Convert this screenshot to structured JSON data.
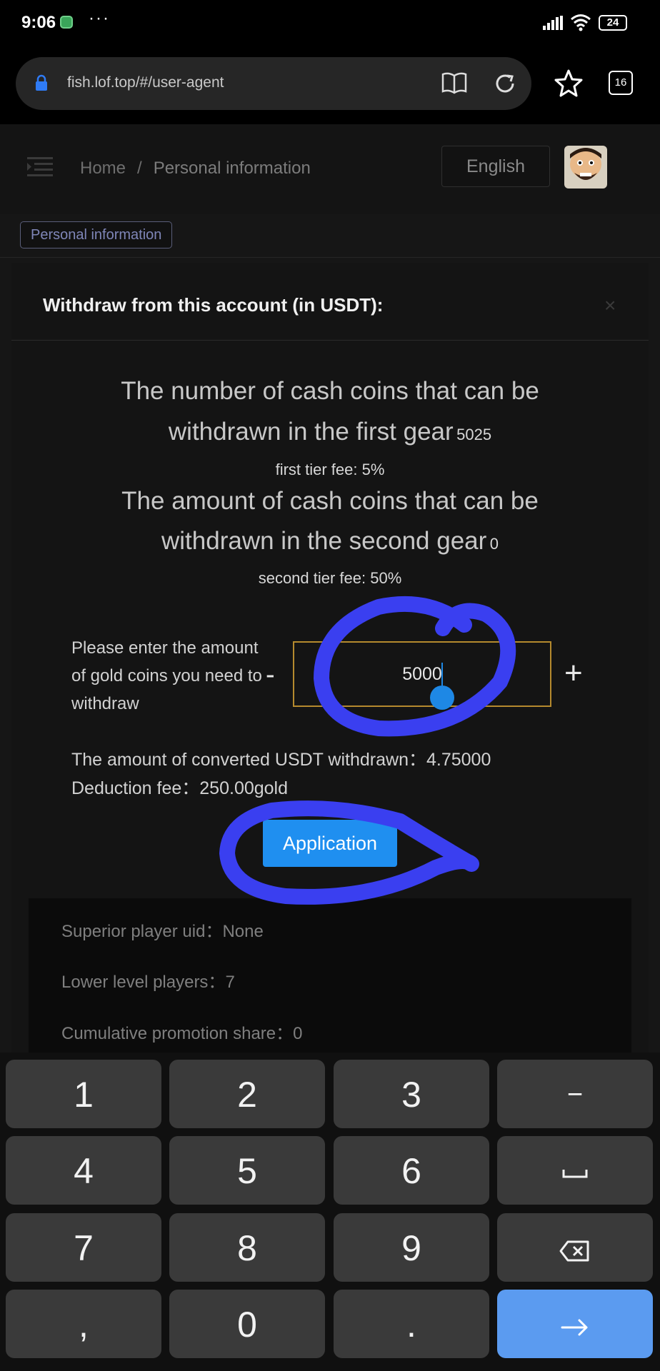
{
  "status_bar": {
    "time": "9:06",
    "dots": "···",
    "battery": "24"
  },
  "browser": {
    "url": "fish.lof.top/#/user-agent",
    "tab_count": "16"
  },
  "header": {
    "breadcrumb_home": "Home",
    "breadcrumb_sep": "/",
    "breadcrumb_current": "Personal information",
    "language": "English"
  },
  "tag": {
    "label": "Personal information"
  },
  "modal": {
    "title": "Withdraw from this account (in USDT):",
    "close": "×",
    "first_gear_line1": "The number of cash coins that can be",
    "first_gear_line2": "withdrawn in the first gear",
    "first_gear_value": "5025",
    "first_fee": "first tier fee: 5%",
    "second_gear_line1": "The amount of cash coins that can be",
    "second_gear_line2": "withdrawn in the second gear",
    "second_gear_value": "0",
    "second_fee": "second tier fee: 50%",
    "amount_label": "Please enter the amount of gold coins you need to withdraw",
    "minus": "-",
    "plus": "+",
    "amount_value": "5000",
    "usdt_label": "The amount of converted USDT withdrawn：",
    "usdt_value": "4.75000",
    "fee_label": "Deduction fee：",
    "fee_value": "250.00gold",
    "apply_button": "Application"
  },
  "stats": {
    "superior_label": "Superior player uid：",
    "superior_value": "None",
    "lower_label": "Lower level players：",
    "lower_value": "7",
    "share_label": "Cumulative promotion share：",
    "share_value": "0"
  },
  "keyboard": {
    "keys": [
      "1",
      "2",
      "3",
      "−",
      "4",
      "5",
      "6",
      "⎵",
      "7",
      "8",
      "9",
      "⌫",
      ",",
      "0",
      ".",
      "→"
    ],
    "icons": {
      "space": "space-bar-icon",
      "backspace": "backspace-icon",
      "enter": "arrow-right-icon"
    }
  },
  "colors": {
    "accent_blue": "#1f8ff0",
    "input_border": "#b58a2e",
    "annotation_blue": "#3a3ff0",
    "enter_key": "#5b9bf0"
  }
}
